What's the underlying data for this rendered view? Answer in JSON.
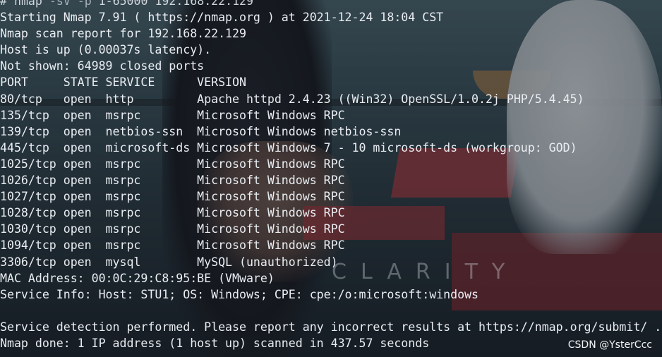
{
  "wallpaper": {
    "watermark_text": "CLARITY"
  },
  "terminal": {
    "prompt_symbol": "#",
    "command": "nmap",
    "options": "-sV -p",
    "args": "1-65000 192.168.22.129",
    "lines": {
      "starting": "Starting Nmap 7.91 ( https://nmap.org ) at 2021-12-24 18:04 CST",
      "report": "Nmap scan report for 192.168.22.129",
      "host_up": "Host is up (0.00037s latency).",
      "not_shown": "Not shown: 64989 closed ports",
      "mac": "MAC Address: 00:0C:29:C8:95:BE (VMware)",
      "service_info": "Service Info: Host: STU1; OS: Windows; CPE: cpe:/o:microsoft:windows",
      "service_detection": "Service detection performed. Please report any incorrect results at https://nmap.org/submit/ .",
      "done": "Nmap done: 1 IP address (1 host up) scanned in 437.57 seconds"
    },
    "table_header": "PORT     STATE SERVICE      VERSION",
    "ports": [
      "80/tcp   open  http         Apache httpd 2.4.23 ((Win32) OpenSSL/1.0.2j PHP/5.4.45)",
      "135/tcp  open  msrpc        Microsoft Windows RPC",
      "139/tcp  open  netbios-ssn  Microsoft Windows netbios-ssn",
      "445/tcp  open  microsoft-ds Microsoft Windows 7 - 10 microsoft-ds (workgroup: GOD)",
      "1025/tcp open  msrpc        Microsoft Windows RPC",
      "1026/tcp open  msrpc        Microsoft Windows RPC",
      "1027/tcp open  msrpc        Microsoft Windows RPC",
      "1028/tcp open  msrpc        Microsoft Windows RPC",
      "1030/tcp open  msrpc        Microsoft Windows RPC",
      "1094/tcp open  msrpc        Microsoft Windows RPC",
      "3306/tcp open  mysql        MySQL (unauthorized)"
    ]
  },
  "csdn_watermark": "CSDN @YsterCcc"
}
